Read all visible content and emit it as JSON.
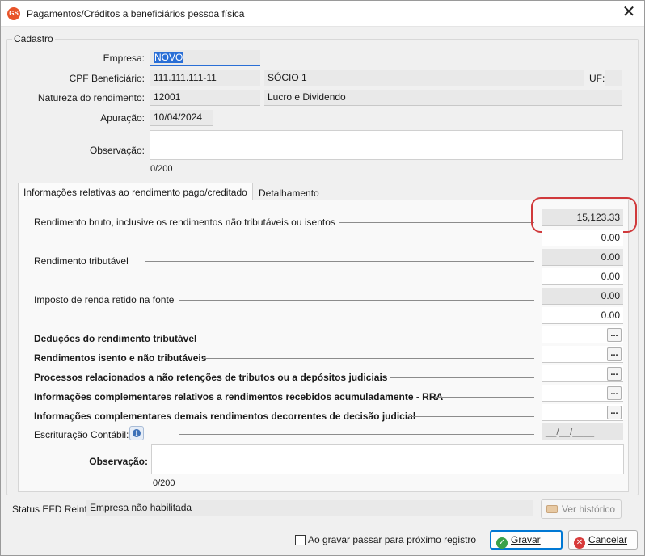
{
  "window": {
    "app_icon": "GS",
    "title": "Pagamentos/Créditos a beneficiários pessoa física",
    "close_glyph": "✕"
  },
  "cadastro": {
    "legend": "Cadastro",
    "empresa_label": "Empresa:",
    "empresa_value": "NOVO",
    "cpf_label": "CPF Beneficiário:",
    "cpf_value": "111.111.111-11",
    "beneficiario_name": "SÓCIO 1",
    "uf_label": "UF:",
    "uf_value": "",
    "natureza_label": "Natureza do rendimento:",
    "natureza_code": "12001",
    "natureza_desc": "Lucro e Dividendo",
    "apuracao_label": "Apuração:",
    "apuracao_value": "10/04/2024",
    "observacao_label": "Observação:",
    "observacao_value": "",
    "observacao_counter": "0/200"
  },
  "tabs": [
    {
      "label": "Informações relativas ao rendimento pago/creditado",
      "active": true
    },
    {
      "label": "Detalhamento",
      "active": false
    }
  ],
  "info": {
    "rendimento_bruto_label": "Rendimento bruto, inclusive os rendimentos não tributáveis ou isentos",
    "rendimento_bruto_value": "15,123.33",
    "rendimento_bruto_sub": "0.00",
    "rendimento_tributavel_label": "Rendimento tributável",
    "rendimento_tributavel_value1": "0.00",
    "rendimento_tributavel_value2": "0.00",
    "imposto_label": "Imposto de renda retido na fonte",
    "imposto_value1": "0.00",
    "imposto_value2": "0.00",
    "deducoes_label": "Deduções do rendimento tributável",
    "isentos_label": "Rendimentos isento e não tributáveis",
    "processos_label": "Processos relacionados a não retenções de tributos ou a depósitos judiciais",
    "rra_label": "Informações complementares relativos a rendimentos recebidos acumuladamente - RRA",
    "decisao_label": "Informações complementares demais rendimentos decorrentes de decisão judicial",
    "escrituracao_label": "Escrituração Contábil:",
    "escrituracao_date": "__/__/____",
    "observacao_label": "Observação:",
    "observacao_value": "",
    "observacao_counter": "0/200",
    "ellipsis": "..."
  },
  "status": {
    "label": "Status EFD Reinf:",
    "value": "Empresa não habilitada",
    "historico_button": "Ver histórico"
  },
  "footer": {
    "checkbox_label": "Ao gravar passar para próximo registro",
    "checkbox_checked": false,
    "save_button": "Gravar",
    "cancel_button": "Cancelar"
  },
  "colors": {
    "highlight": "#d0393b",
    "selection": "#2a6fd6",
    "save_icon": "#3aa14a",
    "cancel_icon": "#d73a3a"
  }
}
